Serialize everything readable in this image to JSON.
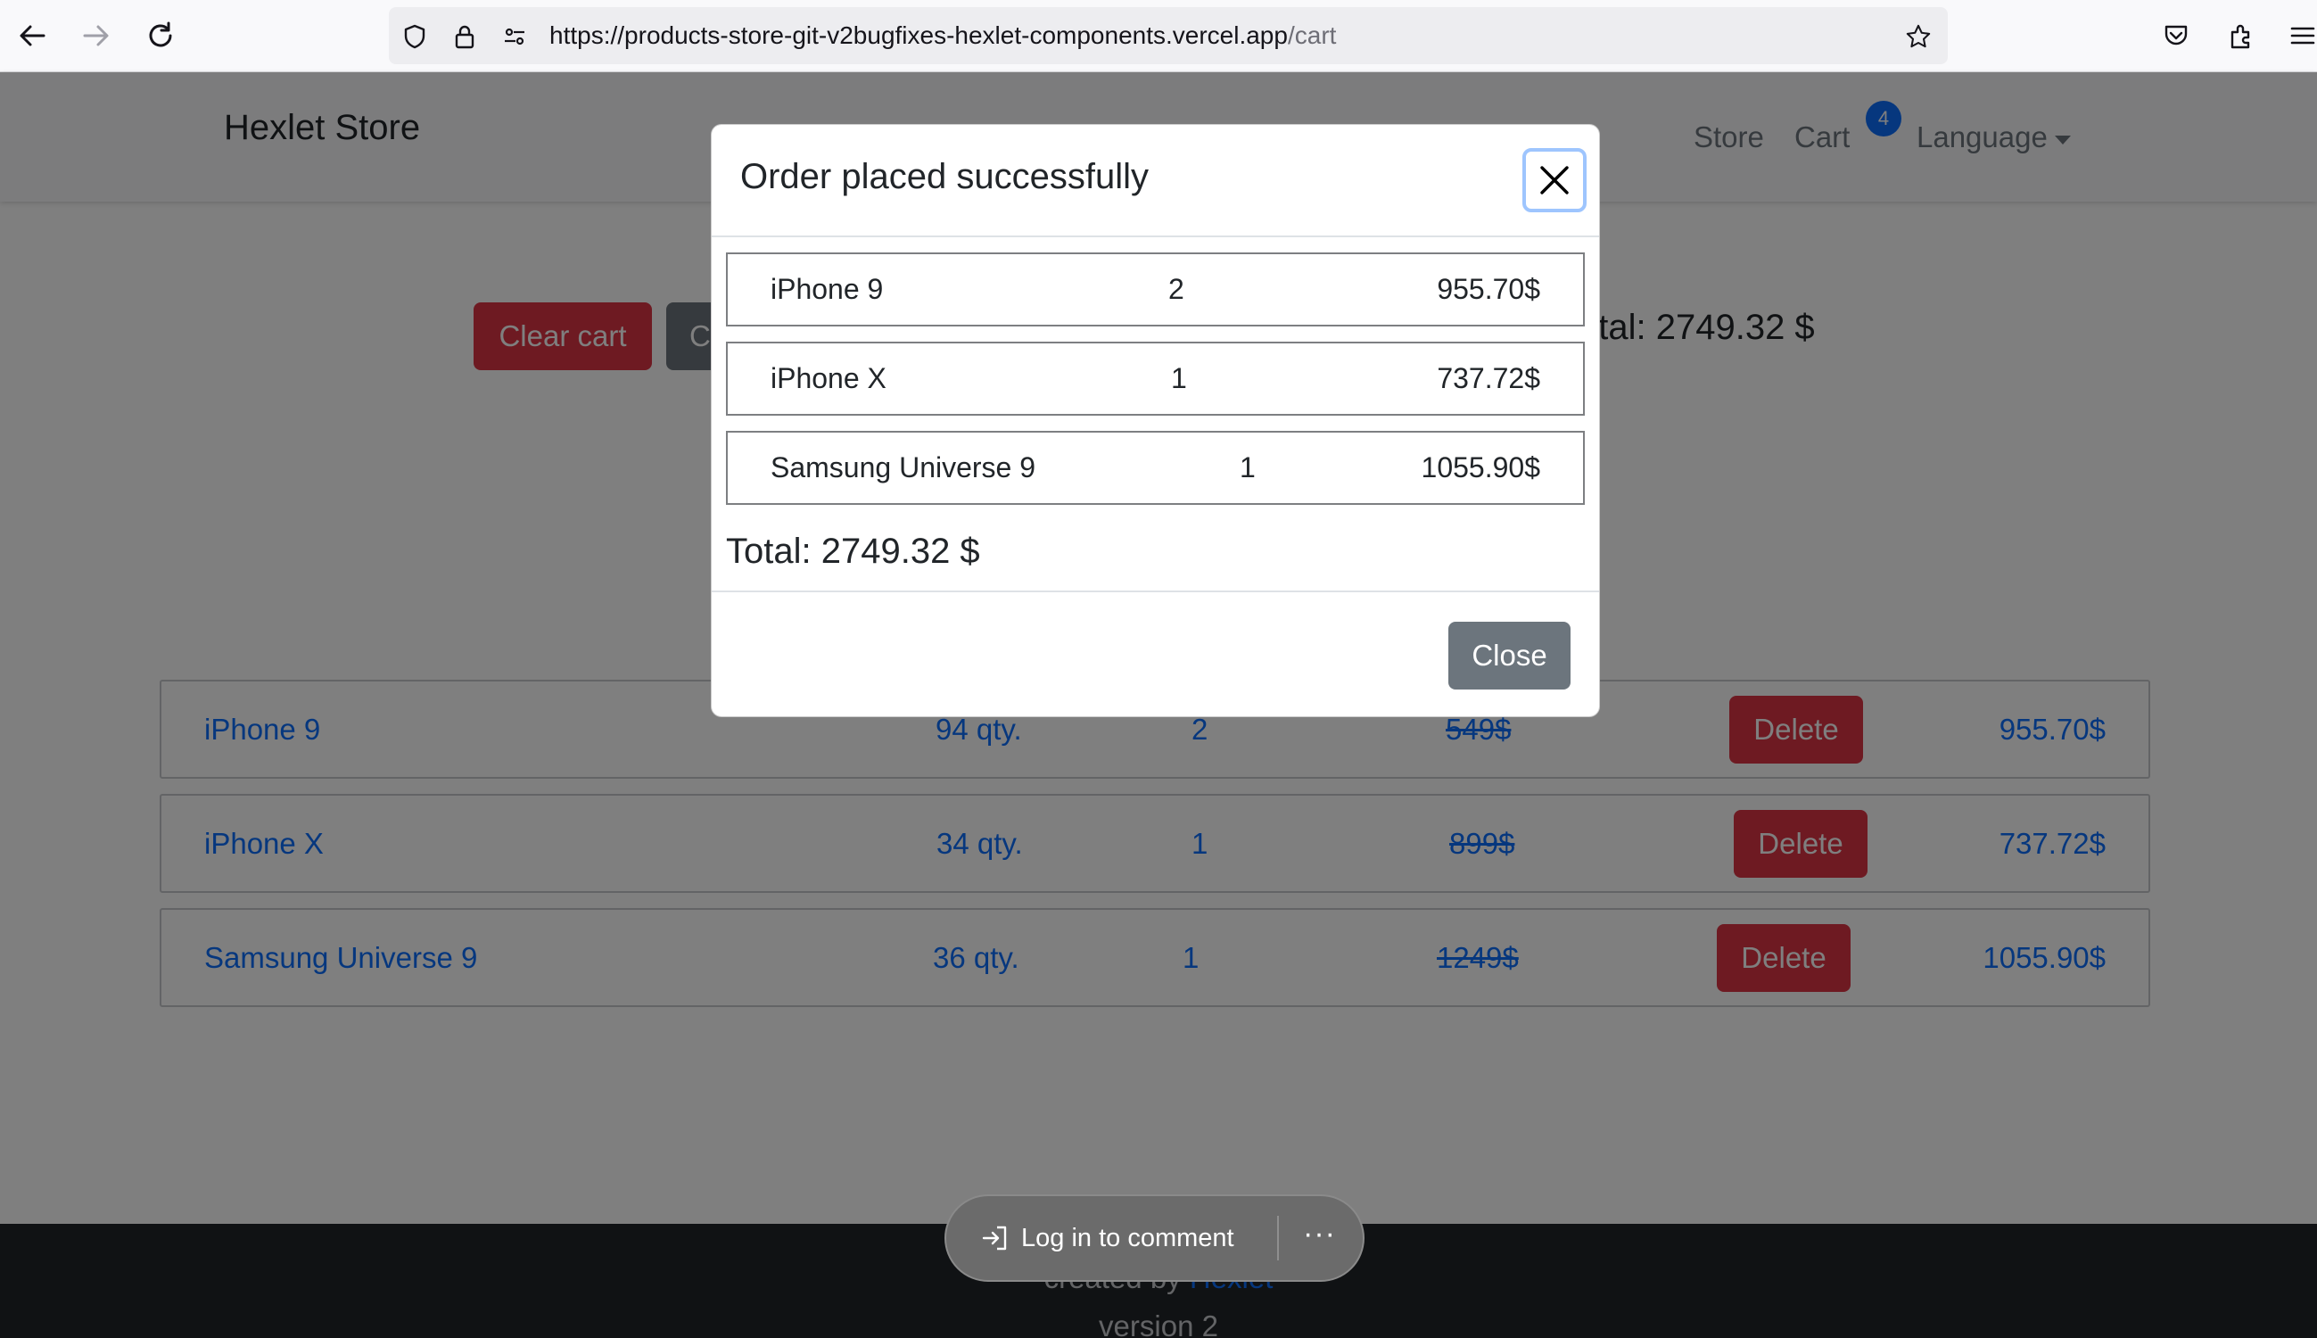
{
  "browser": {
    "url_host": "https://products-store-git-v2bugfixes-hexlet-components.vercel.app",
    "url_path": "/cart"
  },
  "navbar": {
    "brand": "Hexlet Store",
    "store_link": "Store",
    "cart_link": "Cart",
    "cart_badge": "4",
    "language_link": "Language"
  },
  "cart": {
    "clear_label": "Clear cart",
    "checkout_label_visible": "C",
    "total_visible": "otal: 2749.32 $",
    "delete_label": "Delete",
    "rows": [
      {
        "name": "iPhone 9",
        "stock": "94 qty.",
        "count": "2",
        "old_price": "549$",
        "price": "955.70$"
      },
      {
        "name": "iPhone X",
        "stock": "34 qty.",
        "count": "1",
        "old_price": "899$",
        "price": "737.72$"
      },
      {
        "name": "Samsung Universe 9",
        "stock": "36 qty.",
        "count": "1",
        "old_price": "1249$",
        "price": "1055.90$"
      }
    ]
  },
  "modal": {
    "title": "Order placed successfully",
    "rows": [
      {
        "name": "iPhone 9",
        "count": "2",
        "price": "955.70$"
      },
      {
        "name": "iPhone X",
        "count": "1",
        "price": "737.72$"
      },
      {
        "name": "Samsung Universe 9",
        "count": "1",
        "price": "1055.90$"
      }
    ],
    "total": "Total: 2749.32 $",
    "close_label": "Close"
  },
  "footer": {
    "created_by": "created by",
    "hexlet_link": "Hexlet",
    "version": "version 2"
  },
  "comment_bar": {
    "login_label": "Log in to comment",
    "more_label": "···"
  },
  "colors": {
    "primary": "#0d6efd",
    "danger": "#dc3545",
    "secondary": "#6c757d",
    "footer_bg": "#212529"
  },
  "icons": [
    "back-arrow-icon",
    "forward-arrow-icon",
    "reload-icon",
    "shield-icon",
    "lock-icon",
    "permissions-icon",
    "bookmark-star-icon",
    "pocket-icon",
    "extensions-icon",
    "menu-icon",
    "close-icon",
    "login-icon",
    "more-icon"
  ]
}
